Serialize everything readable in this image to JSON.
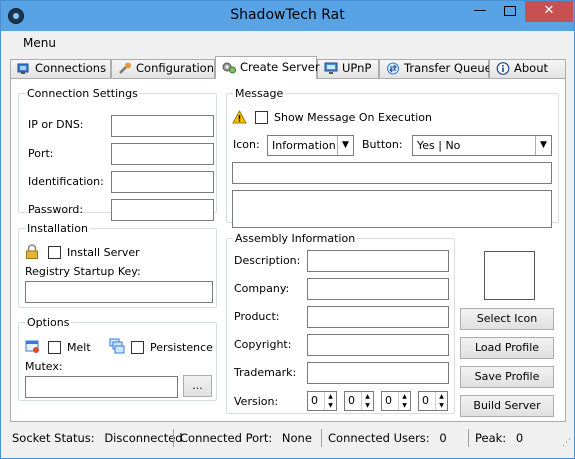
{
  "window": {
    "title": "ShadowTech Rat",
    "min": "—",
    "max": "□",
    "close": "✕"
  },
  "menu": {
    "label": "Menu"
  },
  "tabs": [
    {
      "label": "Connections",
      "icon": "connections-icon"
    },
    {
      "label": "Configuration",
      "icon": "wrench-icon"
    },
    {
      "label": "Create Server",
      "icon": "gears-icon",
      "active": true
    },
    {
      "label": "UPnP",
      "icon": "network-icon"
    },
    {
      "label": "Transfer Queue",
      "icon": "transfer-icon"
    },
    {
      "label": "About",
      "icon": "info-icon"
    }
  ],
  "connection_settings": {
    "title": "Connection Settings",
    "ip_label": "IP or DNS:",
    "ip_value": "",
    "port_label": "Port:",
    "port_value": "",
    "identification_label": "Identification:",
    "identification_value": "",
    "password_label": "Password:",
    "password_value": ""
  },
  "message": {
    "title": "Message",
    "show_label": "Show Message On Execution",
    "icon_label": "Icon:",
    "icon_value": "Information",
    "button_label": "Button:",
    "button_value": "Yes | No",
    "title_value": "",
    "body_value": ""
  },
  "installation": {
    "title": "Installation",
    "install_label": "Install Server",
    "registry_label": "Registry Startup Key:",
    "registry_value": ""
  },
  "options": {
    "title": "Options",
    "melt_label": "Melt",
    "persistence_label": "Persistence",
    "mutex_label": "Mutex:",
    "mutex_value": "",
    "browse_label": "..."
  },
  "assembly": {
    "title": "Assembly Information",
    "description_label": "Description:",
    "company_label": "Company:",
    "product_label": "Product:",
    "copyright_label": "Copyright:",
    "trademark_label": "Trademark:",
    "version_label": "Version:",
    "version": [
      "0",
      "0",
      "0",
      "0"
    ]
  },
  "actions": {
    "select_icon": "Select Icon",
    "load_profile": "Load Profile",
    "save_profile": "Save Profile",
    "build_server": "Build Server"
  },
  "status": {
    "socket_label": "Socket Status:",
    "socket_value": "Disconnected",
    "port_label": "Connected Port:",
    "port_value": "None",
    "users_label": "Connected Users:",
    "users_value": "0",
    "peak_label": "Peak:",
    "peak_value": "0"
  },
  "colors": {
    "titlebar": "#57a3e6",
    "close": "#c75050",
    "warning": "#f2c200"
  }
}
